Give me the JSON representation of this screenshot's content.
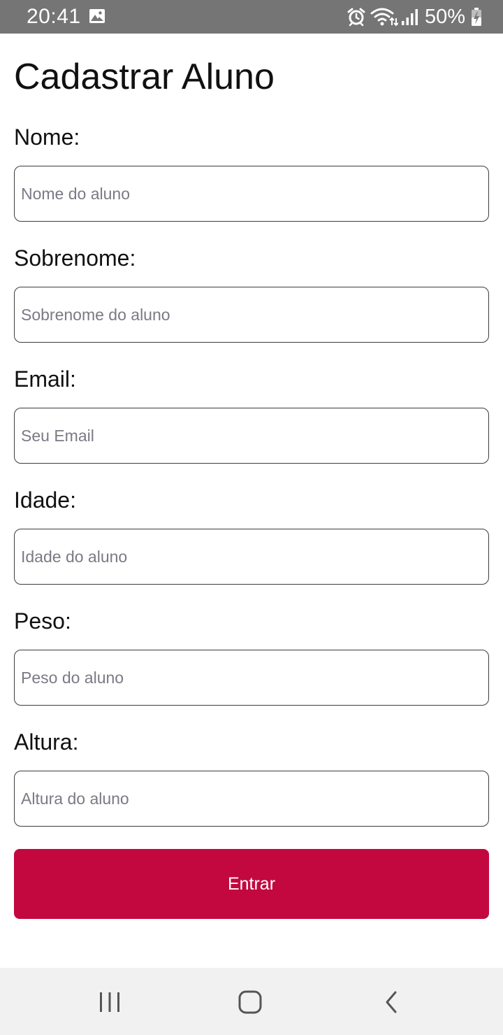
{
  "status_bar": {
    "time": "20:41",
    "battery_percent": "50%",
    "icons": [
      "gallery-icon",
      "alarm-icon",
      "wifi-icon",
      "signal-icon",
      "battery-charging-icon"
    ]
  },
  "form": {
    "title": "Cadastrar Aluno",
    "fields": [
      {
        "label": "Nome:",
        "placeholder": "Nome do aluno",
        "value": ""
      },
      {
        "label": "Sobrenome:",
        "placeholder": "Sobrenome do aluno",
        "value": ""
      },
      {
        "label": "Email:",
        "placeholder": "Seu Email",
        "value": ""
      },
      {
        "label": "Idade:",
        "placeholder": "Idade do aluno",
        "value": ""
      },
      {
        "label": "Peso:",
        "placeholder": "Peso do aluno",
        "value": ""
      },
      {
        "label": "Altura:",
        "placeholder": "Altura do aluno",
        "value": ""
      }
    ],
    "submit_label": "Entrar"
  },
  "navigation_bar": {
    "buttons": [
      "recent-apps-icon",
      "home-icon",
      "back-icon"
    ]
  },
  "colors": {
    "status_bar": "#757575",
    "primary_button": "#c3083f",
    "nav_bar": "#f1f1f1"
  }
}
